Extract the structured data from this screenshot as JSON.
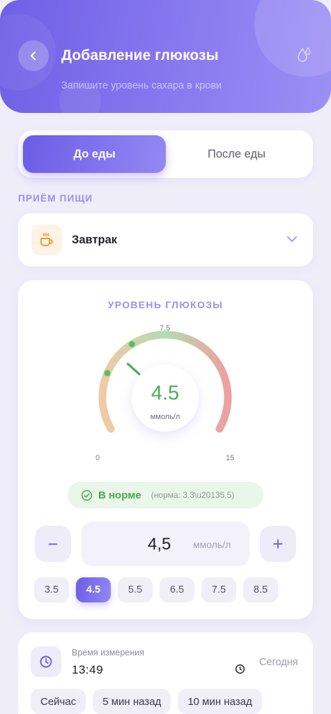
{
  "header": {
    "title": "Добавление глюкозы",
    "subtitle": "Запишите уровень сахара в крови"
  },
  "segment": {
    "options": [
      "До еды",
      "После еды"
    ],
    "selected": "До еды"
  },
  "meal": {
    "section_label": "ПРИЁМ ПИЩИ",
    "selected": "Завтрак",
    "icon": "coffee-cup-icon"
  },
  "glucose": {
    "title": "УРОВЕНЬ ГЛЮКОЗЫ",
    "value": 4.5,
    "value_display": "4.5",
    "unit": "ммоль/л",
    "min": 0,
    "max": 15,
    "min_label": "0",
    "max_label": "15",
    "marker_label": "7.5",
    "normal_range": [
      3.3,
      5.5
    ],
    "status": "В норме",
    "status_norm": "(норма: 3.3\\u20135.5)",
    "colors": {
      "low": "#f2c9a6",
      "normal": "#9fd49f",
      "high": "#ee9c9c",
      "value": "#4cae52",
      "accent": "#6c5ce7"
    }
  },
  "stepper": {
    "value": "4,5",
    "unit": "ммоль/л",
    "minus": "−",
    "plus": "+"
  },
  "presets": [
    "3.5",
    "4.5",
    "5.5",
    "6.5",
    "7.5",
    "8.5"
  ],
  "preset_selected": "4.5",
  "time": {
    "label": "Время измерения",
    "value": "13:49",
    "date": "Сегодня",
    "quick": [
      "Сейчас",
      "5 мин назад",
      "10 мин назад"
    ]
  }
}
